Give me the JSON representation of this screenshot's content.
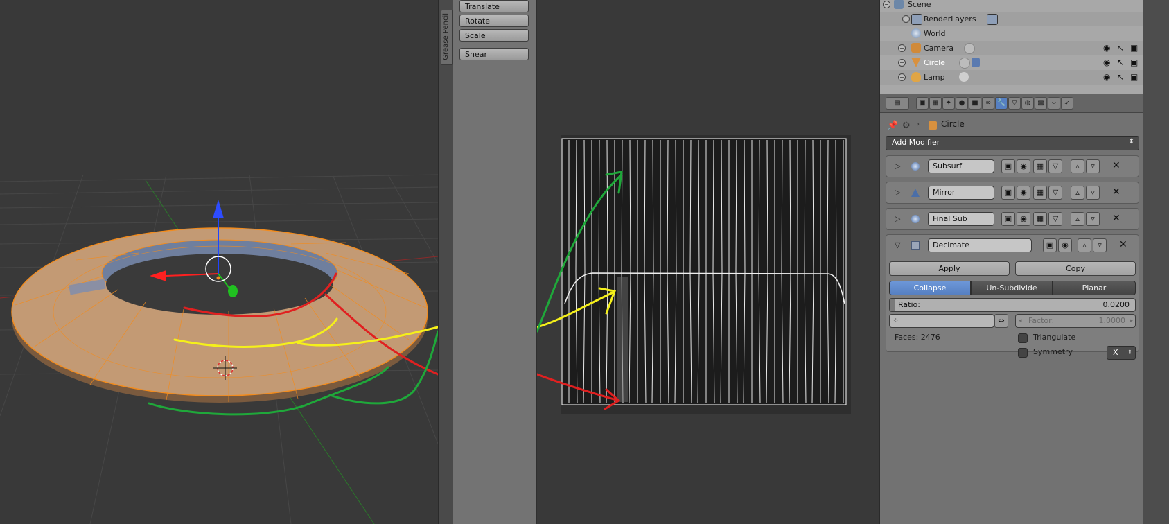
{
  "tool_shelf": {
    "tab_label": "Grease Pencil",
    "buttons": [
      "Translate",
      "Rotate",
      "Scale",
      "Shear"
    ]
  },
  "outliner": {
    "rows": [
      {
        "label": "Scene"
      },
      {
        "label": "RenderLayers"
      },
      {
        "label": "World"
      },
      {
        "label": "Camera"
      },
      {
        "label": "Circle"
      },
      {
        "label": "Lamp"
      }
    ]
  },
  "properties": {
    "breadcrumb_object": "Circle",
    "add_modifier_label": "Add Modifier",
    "modifiers": [
      {
        "name": "Subsurf",
        "collapsed": true
      },
      {
        "name": "Mirror",
        "collapsed": true
      },
      {
        "name": "Final Sub",
        "collapsed": true
      }
    ],
    "decimate": {
      "name": "Decimate",
      "apply_label": "Apply",
      "copy_label": "Copy",
      "modes": [
        "Collapse",
        "Un-Subdivide",
        "Planar"
      ],
      "active_mode": "Collapse",
      "ratio_label": "Ratio:",
      "ratio_value": "0.0200",
      "factor_label": "Factor:",
      "factor_value": "1.0000",
      "faces_label": "Faces: 2476",
      "triangulate_label": "Triangulate",
      "symmetry_label": "Symmetry",
      "symmetry_axis": "X"
    }
  },
  "colors": {
    "accent": "#5680c2",
    "mesh": "#c39a74",
    "wire": "#f28c1e",
    "annotation_red": "#e02020",
    "annotation_yellow": "#f5f01a",
    "annotation_green": "#1fa83a"
  }
}
